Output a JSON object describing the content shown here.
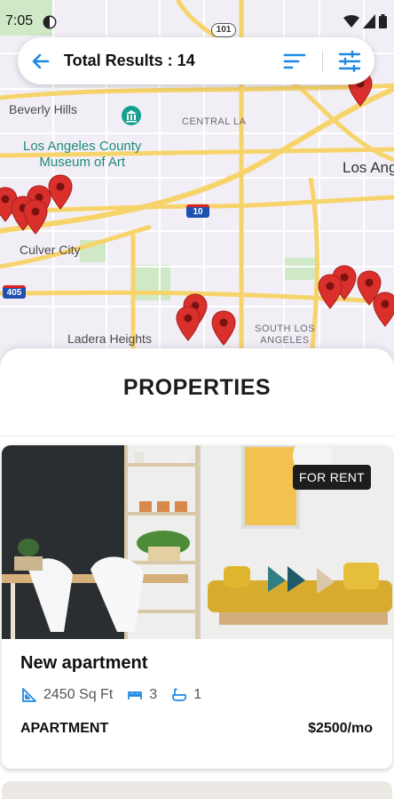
{
  "status_bar": {
    "time": "7:05"
  },
  "top_bar": {
    "title": "Total Results : 14"
  },
  "map": {
    "labels": {
      "beverly_hills": "Beverly Hills",
      "central_la": "CENTRAL LA",
      "lacma_line1": "Los Angeles County",
      "lacma_line2": "Museum of Art",
      "los_angeles": "Los Ang",
      "culver_city": "Culver City",
      "ladera_heights": "Ladera Heights",
      "south_la_line1": "SOUTH LOS",
      "south_la_line2": "ANGELES"
    },
    "shields": {
      "us101": "101",
      "i10": "10",
      "i405": "405"
    }
  },
  "sheet": {
    "title": "PROPERTIES"
  },
  "listing": {
    "badge": "FOR RENT",
    "title": "New apartment",
    "area": "2450 Sq Ft",
    "bedrooms": "3",
    "bathrooms": "1",
    "type": "APARTMENT",
    "price": "$2500/mo"
  },
  "colors": {
    "accent": "#1e88e5",
    "pin": "#d9302c",
    "badge": "#1d1d1d",
    "road": "#f7d46b"
  }
}
